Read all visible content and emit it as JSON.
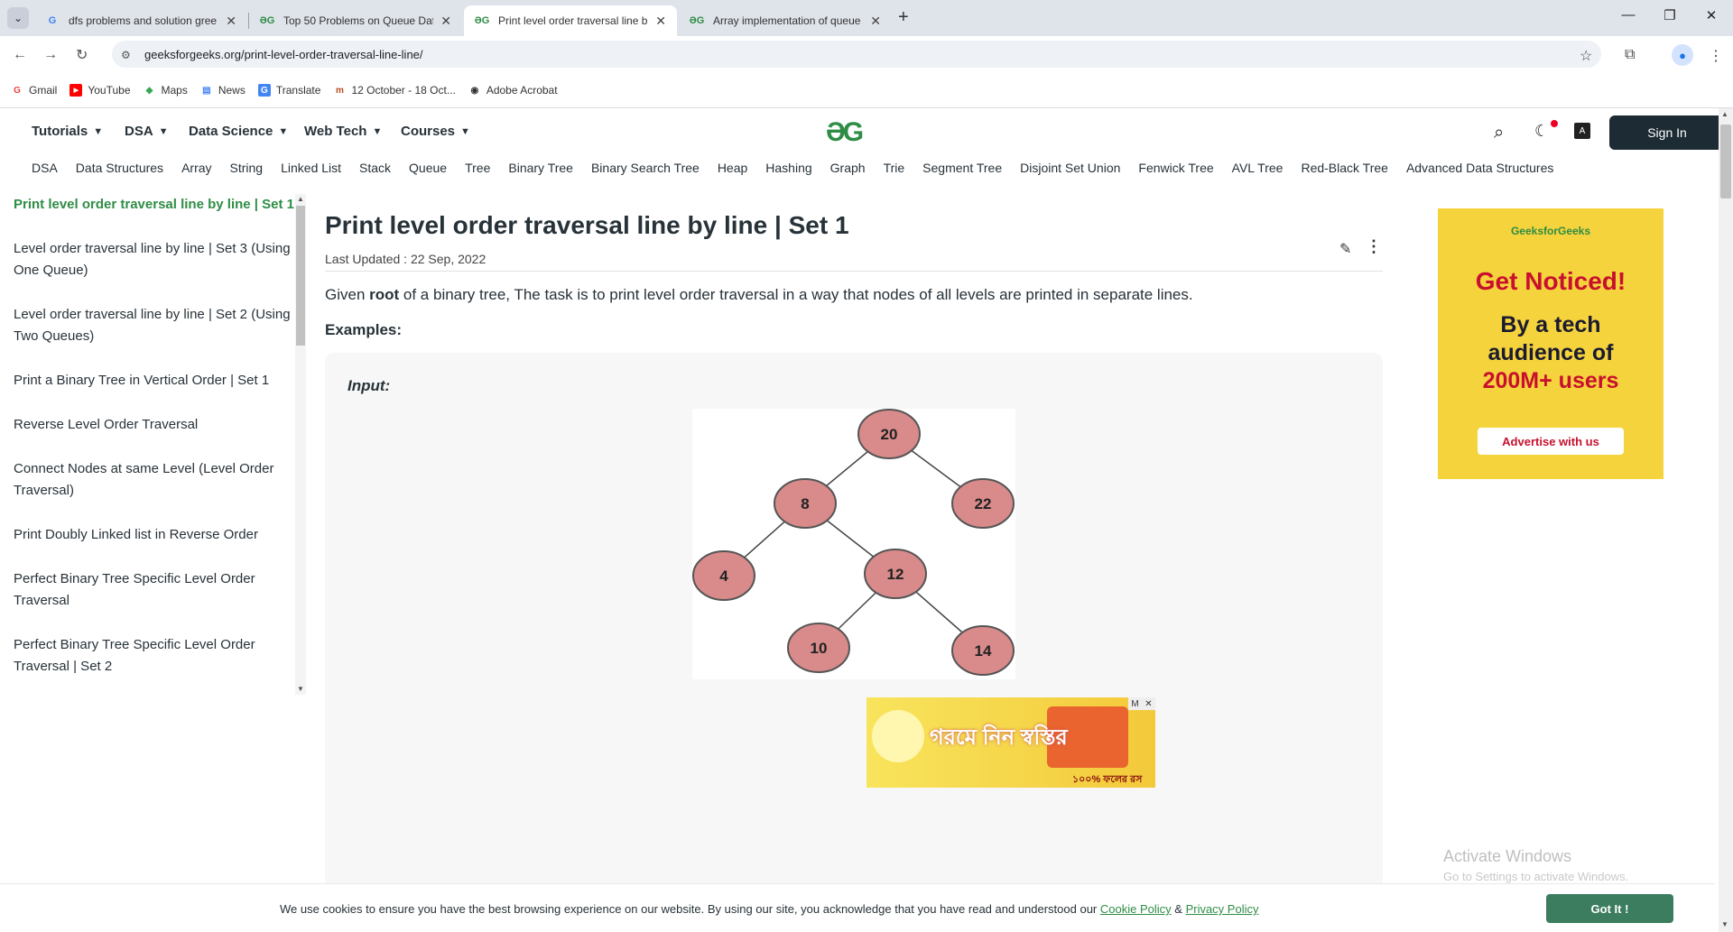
{
  "browser": {
    "tabs": [
      {
        "title": "dfs problems and solution gree",
        "icon": "google-icon",
        "active": false
      },
      {
        "title": "Top 50 Problems on Queue Dat",
        "icon": "gfg-icon",
        "active": false
      },
      {
        "title": "Print level order traversal line b",
        "icon": "gfg-icon",
        "active": true
      },
      {
        "title": "Array implementation of queue",
        "icon": "gfg-icon",
        "active": false
      }
    ],
    "close_glyph": "✕",
    "new_tab_glyph": "+",
    "address": "geeksforgeeks.org/print-level-order-traversal-line-line/",
    "bookmarks": [
      {
        "label": "Gmail",
        "icon": "G",
        "color": "#ea4335"
      },
      {
        "label": "YouTube",
        "icon": "▶",
        "color": "#ff0000"
      },
      {
        "label": "Maps",
        "icon": "◆",
        "color": "#34a853"
      },
      {
        "label": "News",
        "icon": "▤",
        "color": "#4285f4"
      },
      {
        "label": "Translate",
        "icon": "G",
        "color": "#4285f4"
      },
      {
        "label": "12 October - 18 Oct...",
        "icon": "m",
        "color": "#b94a1c"
      },
      {
        "label": "Adobe Acrobat",
        "icon": "◉",
        "color": "#333333"
      }
    ]
  },
  "header": {
    "menus": [
      "Tutorials",
      "DSA",
      "Data Science",
      "Web Tech",
      "Courses"
    ],
    "logo": "ƏG",
    "sign_in": "Sign In",
    "subnav": [
      "DSA",
      "Data Structures",
      "Array",
      "String",
      "Linked List",
      "Stack",
      "Queue",
      "Tree",
      "Binary Tree",
      "Binary Search Tree",
      "Heap",
      "Hashing",
      "Graph",
      "Trie",
      "Segment Tree",
      "Disjoint Set Union",
      "Fenwick Tree",
      "AVL Tree",
      "Red-Black Tree",
      "Advanced Data Structures"
    ]
  },
  "sidebar": {
    "items": [
      {
        "label": "Print level order traversal line by line | Set 1",
        "active": true
      },
      {
        "label": "Level order traversal line by line | Set 3 (Using One Queue)",
        "active": false
      },
      {
        "label": "Level order traversal line by line | Set 2 (Using Two Queues)",
        "active": false
      },
      {
        "label": "Print a Binary Tree in Vertical Order | Set 1",
        "active": false
      },
      {
        "label": "Reverse Level Order Traversal",
        "active": false
      },
      {
        "label": "Connect Nodes at same Level (Level Order Traversal)",
        "active": false
      },
      {
        "label": "Print Doubly Linked list in Reverse Order",
        "active": false
      },
      {
        "label": "Perfect Binary Tree Specific Level Order Traversal",
        "active": false
      },
      {
        "label": "Perfect Binary Tree Specific Level Order Traversal | Set 2",
        "active": false
      }
    ]
  },
  "article": {
    "title": "Print level order traversal line by line | Set 1",
    "last_updated": "Last Updated : 22 Sep, 2022",
    "intro_before": "Given ",
    "intro_bold": "root",
    "intro_after": " of a binary tree, The task is to print level order traversal in a way that nodes of all levels are printed in separate lines.",
    "examples_label": "Examples:",
    "input_label": "Input:",
    "tree": {
      "nodes": [
        "20",
        "8",
        "22",
        "4",
        "12",
        "10",
        "14"
      ],
      "edges": [
        [
          "20",
          "8"
        ],
        [
          "20",
          "22"
        ],
        [
          "8",
          "4"
        ],
        [
          "8",
          "12"
        ],
        [
          "12",
          "10"
        ],
        [
          "12",
          "14"
        ]
      ]
    }
  },
  "ads": {
    "right": {
      "brand": "GeeksforGeeks",
      "headline": "Get Noticed!",
      "line1": "By a tech",
      "line2": "audience of",
      "line3": "200M+ users",
      "cta": "Advertise with us"
    },
    "banner": {
      "text": "গরমে নিন স্বস্তির",
      "subtext": "১০০% ফলের রস"
    }
  },
  "watermark": {
    "title": "Activate Windows",
    "subtitle": "Go to Settings to activate Windows."
  },
  "cookie": {
    "text": "We use cookies to ensure you have the best browsing experience on our website. By using our site, you acknowledge that you have read and understood our ",
    "cookie_policy": "Cookie Policy",
    "amp": " & ",
    "privacy_policy": "Privacy Policy",
    "button": "Got It !"
  },
  "colors": {
    "brand_green": "#2f8d46",
    "node_fill": "#d98a8a",
    "node_stroke": "#555555"
  }
}
